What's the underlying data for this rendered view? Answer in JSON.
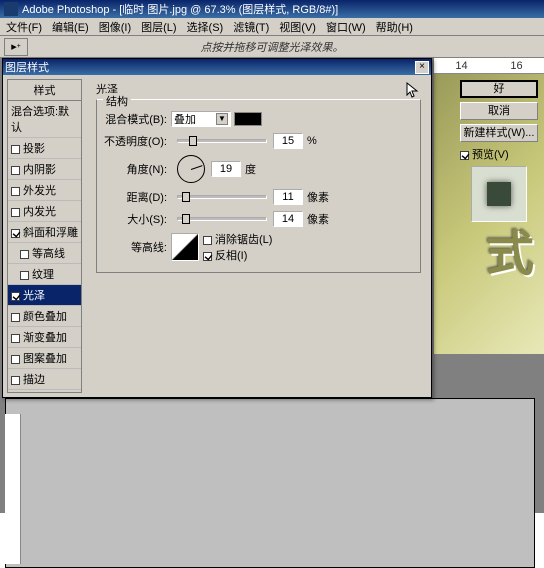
{
  "app": {
    "title": "Adobe Photoshop - [临时 图片.jpg @ 67.3% (图层样式, RGB/8#)]"
  },
  "menu": [
    "文件(F)",
    "编辑(E)",
    "图像(I)",
    "图层(L)",
    "选择(S)",
    "滤镜(T)",
    "视图(V)",
    "窗口(W)",
    "帮助(H)"
  ],
  "toolbar_hint": "点按并拖移可调整光泽效果。",
  "ruler_top": [
    "14",
    "16"
  ],
  "art_text": "式",
  "dialog": {
    "title": "图层样式",
    "styles_head": "样式",
    "blend_opts": "混合选项:默认",
    "list": [
      {
        "label": "投影",
        "checked": false
      },
      {
        "label": "内阴影",
        "checked": false
      },
      {
        "label": "外发光",
        "checked": false
      },
      {
        "label": "内发光",
        "checked": false
      },
      {
        "label": "斜面和浮雕",
        "checked": true
      },
      {
        "label": "等高线",
        "checked": false,
        "indent": true
      },
      {
        "label": "纹理",
        "checked": false,
        "indent": true
      },
      {
        "label": "光泽",
        "checked": true,
        "sel": true
      },
      {
        "label": "颜色叠加",
        "checked": false
      },
      {
        "label": "渐变叠加",
        "checked": false
      },
      {
        "label": "图案叠加",
        "checked": false
      },
      {
        "label": "描边",
        "checked": false
      }
    ],
    "panel_title": "光泽",
    "section": "结构",
    "blend_mode_label": "混合模式(B):",
    "blend_mode_value": "叠加",
    "opacity_label": "不透明度(O):",
    "opacity_value": "15",
    "opacity_unit": "%",
    "angle_label": "角度(N):",
    "angle_value": "19",
    "angle_unit": "度",
    "distance_label": "距离(D):",
    "distance_value": "11",
    "distance_unit": "像素",
    "size_label": "大小(S):",
    "size_value": "14",
    "size_unit": "像素",
    "contour_label": "等高线:",
    "antialias": "消除锯齿(L)",
    "invert": "反相(I)",
    "btns": {
      "ok": "好",
      "cancel": "取消",
      "new": "新建样式(W)...",
      "preview": "预览(V)"
    }
  },
  "chart_data": null
}
